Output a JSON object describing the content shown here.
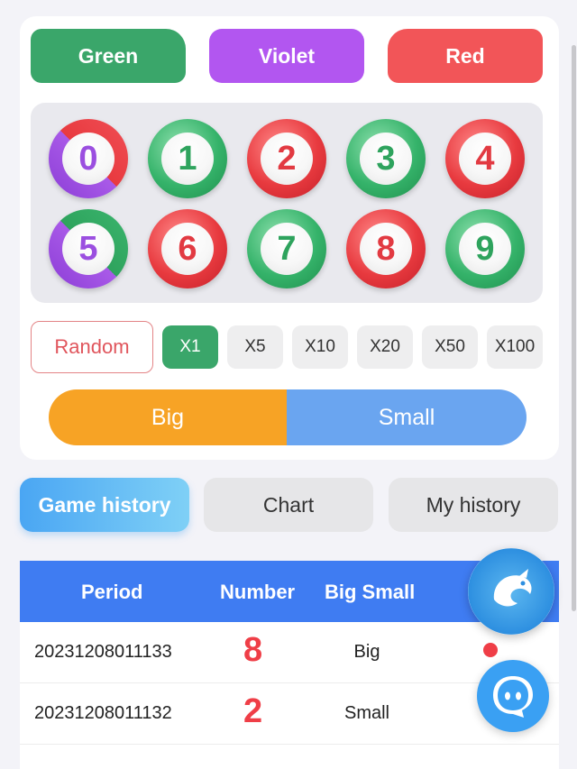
{
  "colors": {
    "green": "#3aa66a",
    "violet": "#b256f0",
    "red": "#f25558",
    "big": "#f7a325",
    "small": "#6aa5f0",
    "table_header": "#3f7cf2"
  },
  "color_buttons": {
    "green": "Green",
    "violet": "Violet",
    "red": "Red"
  },
  "numbers": [
    "0",
    "1",
    "2",
    "3",
    "4",
    "5",
    "6",
    "7",
    "8",
    "9"
  ],
  "multipliers": {
    "random": "Random",
    "options": [
      "X1",
      "X5",
      "X10",
      "X20",
      "X50",
      "X100"
    ],
    "selected": "X1"
  },
  "size_bet": {
    "big": "Big",
    "small": "Small"
  },
  "tabs": {
    "game_history": "Game history",
    "chart": "Chart",
    "my_history": "My history"
  },
  "table": {
    "headers": {
      "period": "Period",
      "number": "Number",
      "big_small": "Big Small"
    },
    "rows": [
      {
        "period": "20231208011133",
        "number": "8",
        "big_small": "Big"
      },
      {
        "period": "20231208011132",
        "number": "2",
        "big_small": "Small"
      }
    ]
  },
  "floating": {
    "dragon": "dragon-logo-icon",
    "chat": "chat-support-icon"
  }
}
